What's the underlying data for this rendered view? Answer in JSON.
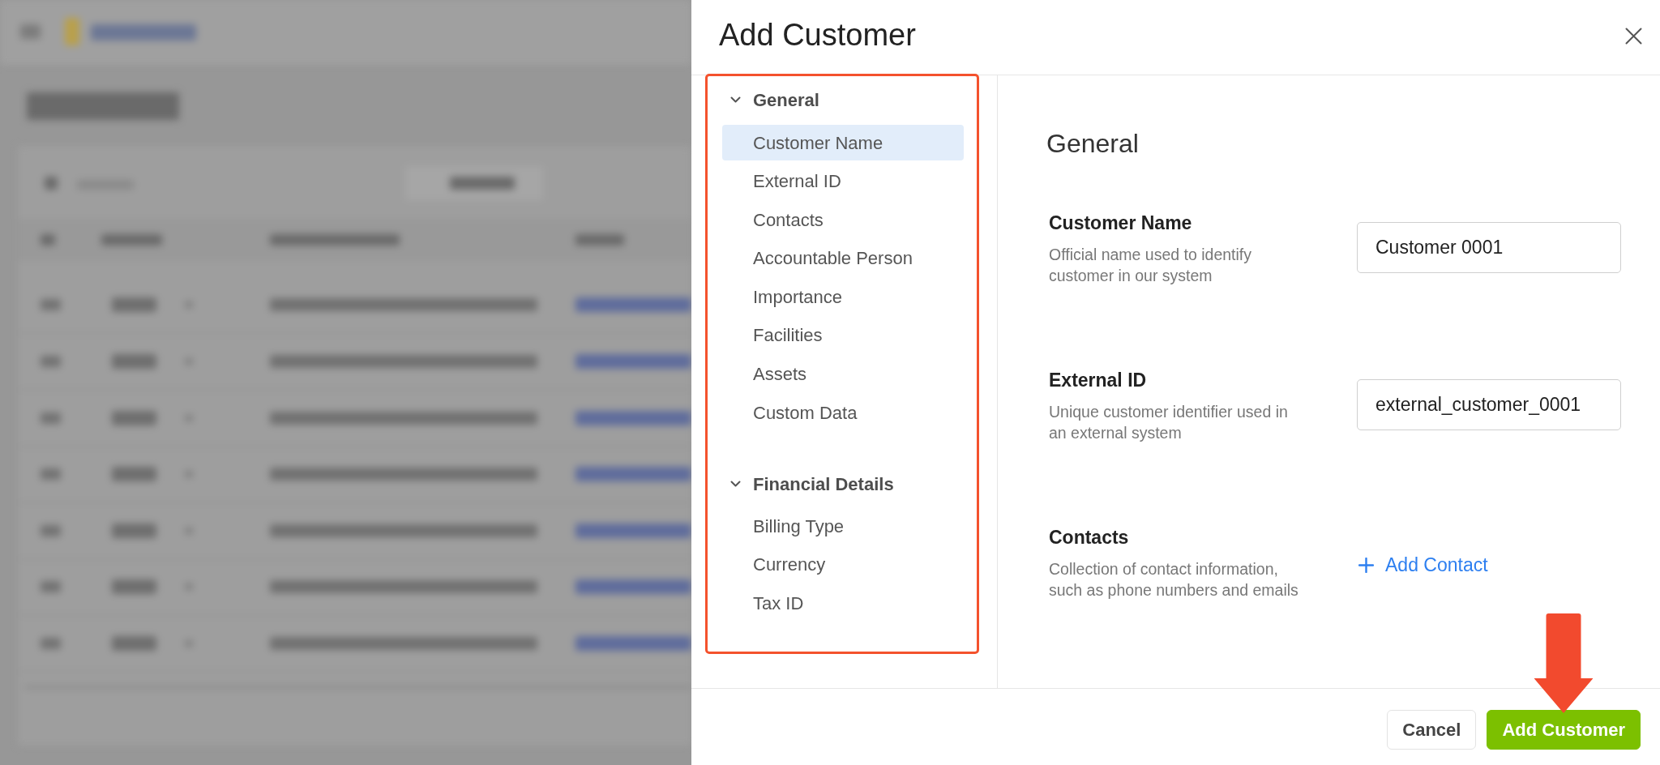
{
  "dialog": {
    "title": "Add Customer"
  },
  "sidebar": {
    "highlighted": true,
    "sections": [
      {
        "title": "General",
        "expanded": true,
        "items": [
          {
            "label": "Customer Name",
            "selected": true
          },
          {
            "label": "External ID",
            "selected": false
          },
          {
            "label": "Contacts",
            "selected": false
          },
          {
            "label": "Accountable Person",
            "selected": false
          },
          {
            "label": "Importance",
            "selected": false
          },
          {
            "label": "Facilities",
            "selected": false
          },
          {
            "label": "Assets",
            "selected": false
          },
          {
            "label": "Custom Data",
            "selected": false
          }
        ]
      },
      {
        "title": "Financial Details",
        "expanded": true,
        "items": [
          {
            "label": "Billing Type",
            "selected": false
          },
          {
            "label": "Currency",
            "selected": false
          },
          {
            "label": "Tax ID",
            "selected": false
          }
        ]
      }
    ]
  },
  "content": {
    "heading": "General",
    "fields": [
      {
        "kind": "text",
        "label": "Customer Name",
        "description": "Official name used to identify customer in our system",
        "value": "Customer 0001"
      },
      {
        "kind": "text",
        "label": "External ID",
        "description": "Unique customer identifier used in an external system",
        "value": "external_customer_0001"
      },
      {
        "kind": "add_link",
        "label": "Contacts",
        "description": "Collection of contact information, such as phone numbers and emails",
        "action": "Add Contact"
      }
    ]
  },
  "footer": {
    "buttons": [
      {
        "label": "Cancel",
        "kind": "secondary",
        "arrow_marked": false
      },
      {
        "label": "Add Customer",
        "kind": "primary",
        "arrow_marked": true
      }
    ]
  }
}
